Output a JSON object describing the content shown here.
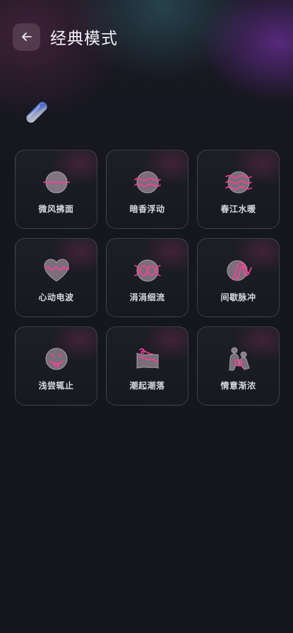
{
  "header": {
    "title": "经典模式",
    "back_icon": "arrow-left-icon"
  },
  "device_icon": "toy-capsule-icon",
  "colors": {
    "accent": "#ff3d9a",
    "background": "#15171e",
    "card_border": "#3a3b44"
  },
  "modes": [
    {
      "label": "微风拂面",
      "icon": "breeze-line-icon"
    },
    {
      "label": "暗香浮动",
      "icon": "double-wave-icon"
    },
    {
      "label": "春江水暖",
      "icon": "triple-wave-icon"
    },
    {
      "label": "心动电波",
      "icon": "heart-wave-icon"
    },
    {
      "label": "涓涓细流",
      "icon": "dna-helix-icon"
    },
    {
      "label": "间歇脉冲",
      "icon": "pulse-s-curve-icon"
    },
    {
      "label": "浅尝辄止",
      "icon": "tongue-face-icon"
    },
    {
      "label": "潮起潮落",
      "icon": "tide-flag-icon"
    },
    {
      "label": "情意渐浓",
      "icon": "couple-hearts-icon"
    }
  ]
}
